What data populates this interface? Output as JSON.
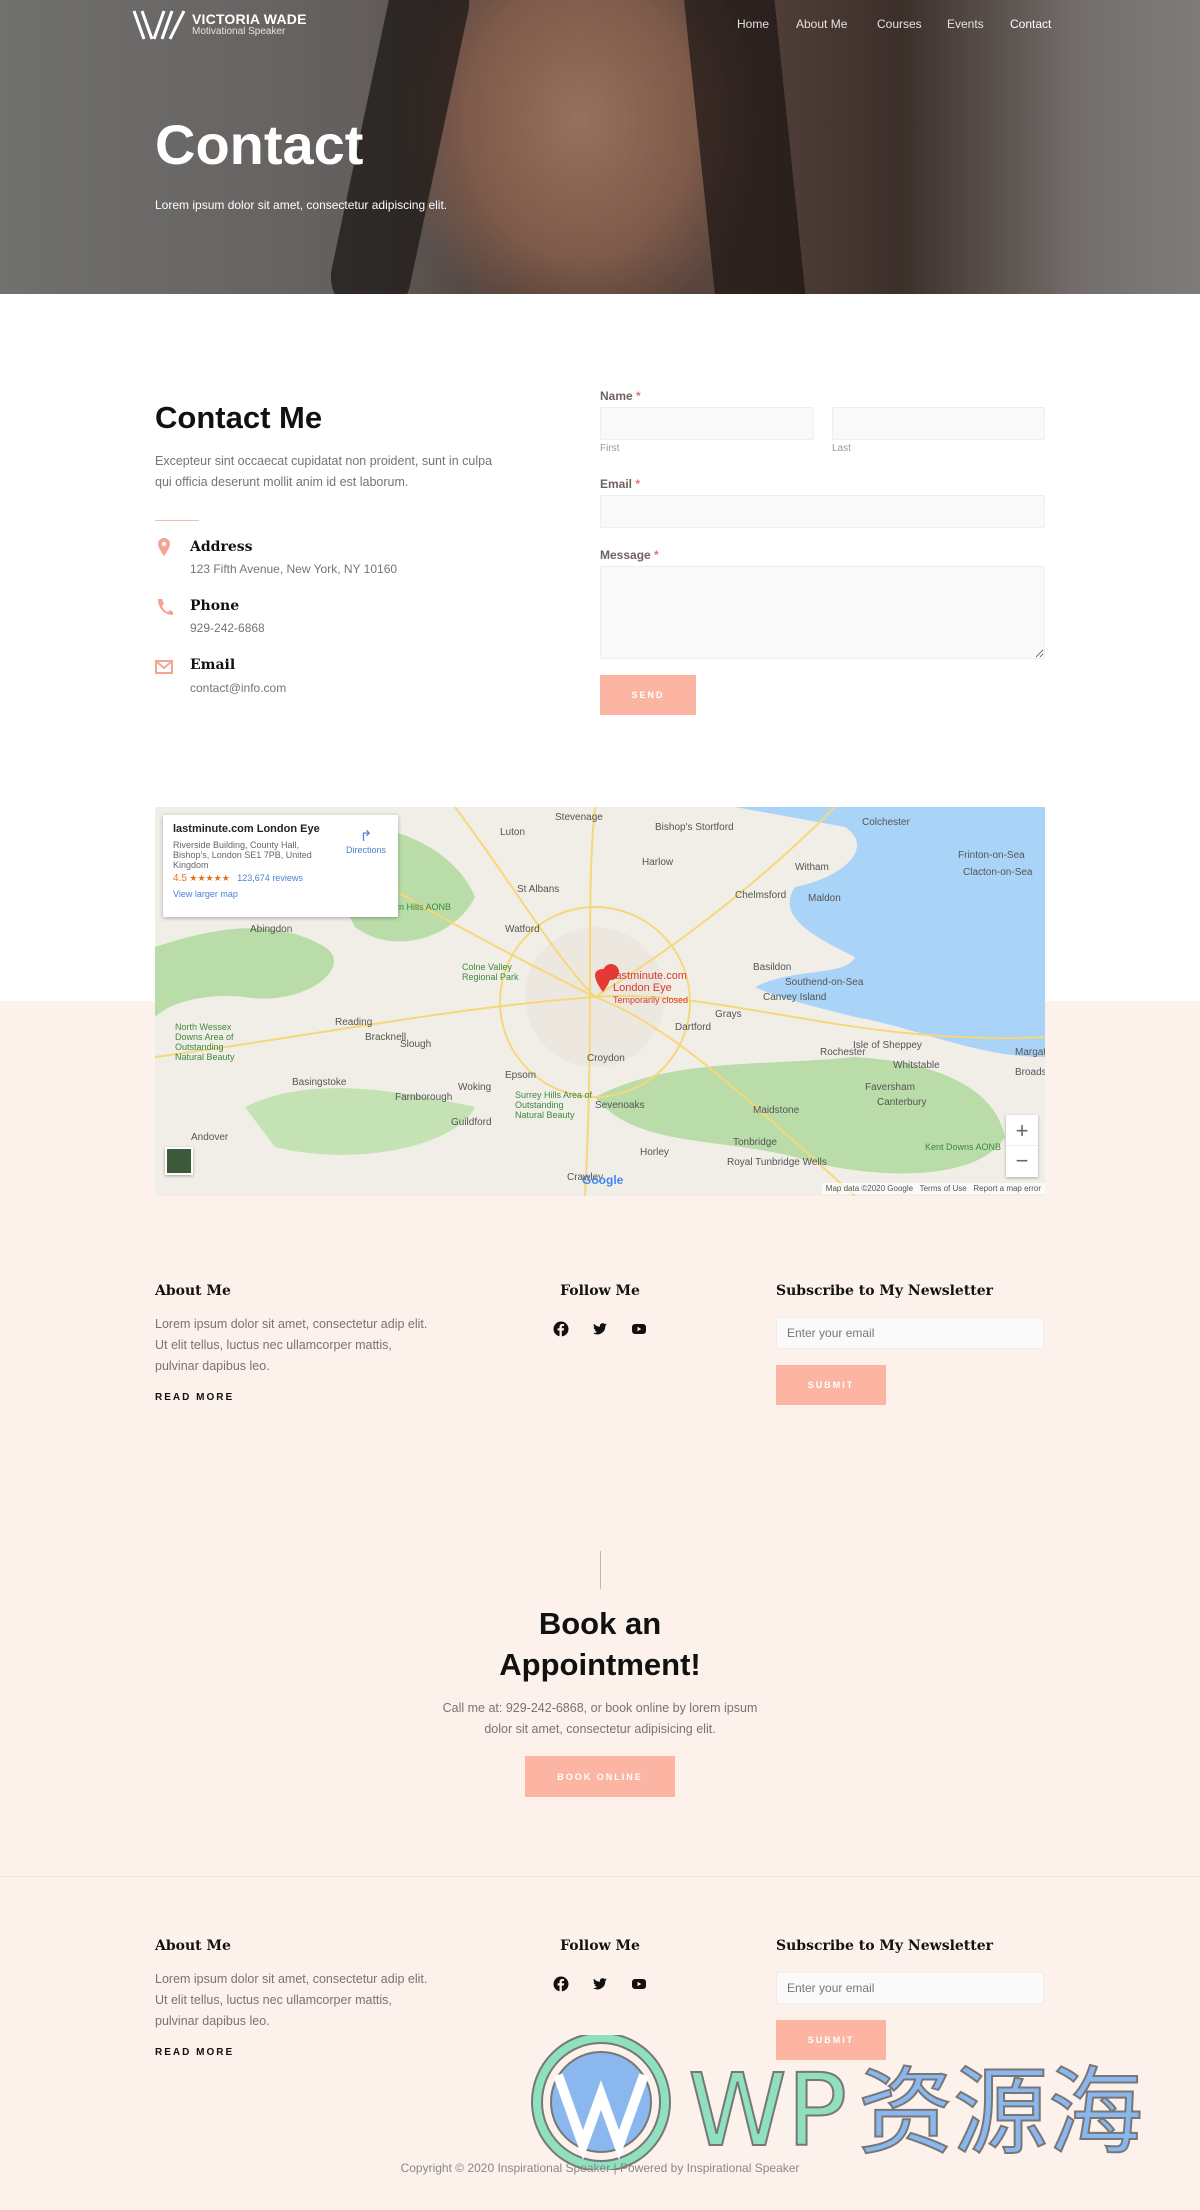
{
  "header": {
    "logo_name": "VICTORIA WADE",
    "logo_tagline": "Motivational Speaker",
    "nav": [
      {
        "label": "Home"
      },
      {
        "label": "About Me"
      },
      {
        "label": "Courses"
      },
      {
        "label": "Events"
      },
      {
        "label": "Contact",
        "active": true
      }
    ]
  },
  "hero": {
    "title": "Contact",
    "subtitle": "Lorem ipsum dolor sit amet, consectetur adipiscing elit."
  },
  "contact": {
    "title": "Contact Me",
    "intro_line1": "Excepteur sint occaecat cupidatat non proident, sunt in culpa",
    "intro_line2": "qui officia deserunt mollit anim id est laborum.",
    "items": [
      {
        "icon": "map-pin-icon",
        "title": "Address",
        "value": "123 Fifth Avenue, New York, NY 10160"
      },
      {
        "icon": "phone-icon",
        "title": "Phone",
        "value": "929-242-6868"
      },
      {
        "icon": "envelope-icon",
        "title": "Email",
        "value": "contact@info.com"
      }
    ]
  },
  "form": {
    "name_label": "Name",
    "required_mark": "*",
    "first_sub": "First",
    "last_sub": "Last",
    "first_value": "",
    "last_value": "",
    "email_label": "Email",
    "email_value": "",
    "message_label": "Message",
    "message_value": "",
    "send_label": "Send"
  },
  "map": {
    "place_name": "lastminute.com London Eye",
    "address_line1": "Riverside Building, County Hall,",
    "address_line2": "Bishop's, London SE1 7PB, United",
    "address_line3": "Kingdom",
    "rating": "4.5",
    "stars": "★★★★★",
    "reviews": "123,674 reviews",
    "larger_map": "View larger map",
    "directions": "Directions",
    "marker_line1": "lastminute.com",
    "marker_line2": "London Eye",
    "marker_status": "Temporarily closed",
    "labels": [
      "Stevenage",
      "Luton",
      "Colchester",
      "Harlow",
      "St Albans",
      "Chelmsford",
      "Watford",
      "Basildon",
      "Southend-on-Sea",
      "Canvey Island",
      "Grays",
      "Dartford",
      "Reading",
      "Slough",
      "Croydon",
      "Epsom",
      "Woking",
      "Guildford",
      "Rochester",
      "Isle of Sheppey",
      "Whitstable",
      "Faversham",
      "Canterbury",
      "Maidstone",
      "Sevenoaks",
      "Tonbridge",
      "Royal Tunbridge Wells",
      "Horley",
      "Crawley",
      "Basingstoke",
      "Farnborough",
      "Bracknell",
      "Andover",
      "Abingdon",
      "Kent Downs AONB",
      "Chiltern Hills AONB",
      "Colne Valley Regional Park",
      "Surrey Hills Area of Outstanding Natural Beauty",
      "North Wessex Downs Area of Outstanding Natural Beauty",
      "Clacton-on-Sea",
      "Frinton-on-Sea",
      "Maldon",
      "Witham",
      "Bishop's Stortford",
      "Margate",
      "Broadstairs"
    ],
    "google": "Google",
    "attribution": "Map data ©2020 Google",
    "terms": "Terms of Use",
    "report": "Report a map error",
    "zoom_in": "+",
    "zoom_out": "−"
  },
  "footer": {
    "about_title": "About Me",
    "about_line1": "Lorem ipsum dolor sit amet, consectetur adip elit.",
    "about_line2": "Ut elit tellus, luctus nec ullamcorper mattis,",
    "about_line3": "pulvinar dapibus leo.",
    "read_more": "Read More",
    "follow_title": "Follow Me",
    "socials": [
      "facebook-icon",
      "twitter-icon",
      "youtube-icon"
    ],
    "newsletter_title": "Subscribe to My Newsletter",
    "email_placeholder": "Enter your email",
    "submit_label": "Submit"
  },
  "booking": {
    "title_line1": "Book an",
    "title_line2": "Appointment!",
    "text_line1": "Call me at: 929-242-6868, or book online by lorem ipsum",
    "text_line2": "dolor sit amet, consectetur adipisicing elit.",
    "button": "Book Online"
  },
  "copyright": "Copyright © 2020 Inspirational Speaker | Powered by Inspirational Speaker",
  "watermark": "WP资源海",
  "colors": {
    "accent": "#fbb5a2",
    "pink_bg": "#fdf1ec",
    "required": "#e57373"
  }
}
